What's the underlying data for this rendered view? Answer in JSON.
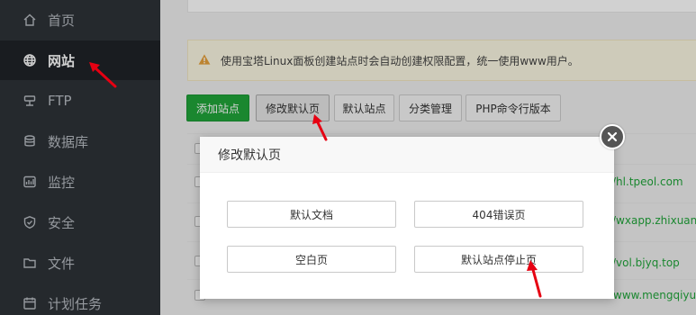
{
  "sidebar": {
    "items": [
      {
        "label": "首页",
        "icon": "home-icon"
      },
      {
        "label": "网站",
        "icon": "globe-icon",
        "active": true
      },
      {
        "label": "FTP",
        "icon": "ftp-icon"
      },
      {
        "label": "数据库",
        "icon": "database-icon"
      },
      {
        "label": "监控",
        "icon": "monitor-icon"
      },
      {
        "label": "安全",
        "icon": "shield-icon"
      },
      {
        "label": "文件",
        "icon": "folder-icon"
      },
      {
        "label": "计划任务",
        "icon": "calendar-icon"
      }
    ]
  },
  "notice": {
    "text": "使用宝塔Linux面板创建站点时会自动创建权限配置，统一使用www用户。",
    "icon": "warning-icon"
  },
  "toolbar": {
    "add_site": "添加站点",
    "modify_default_page": "修改默认页",
    "default_site": "默认站点",
    "category_manage": "分类管理",
    "php_cli_version": "PHP命令行版本"
  },
  "table": {
    "rows": [
      {
        "url": "/hl.tpeol.com"
      },
      {
        "url": "/wxapp.zhixuanc"
      },
      {
        "url": "/vol.bjyq.top"
      },
      {
        "url": "www.mengqiyu"
      }
    ]
  },
  "modal": {
    "title": "修改默认页",
    "buttons": {
      "default_doc": "默认文档",
      "error_404": "404错误页",
      "blank_page": "空白页",
      "default_stop_page": "默认站点停止页"
    }
  },
  "colors": {
    "sidebar_bg": "#2e3237",
    "accent_green": "#20a53a",
    "annotation_red": "#e60012"
  }
}
